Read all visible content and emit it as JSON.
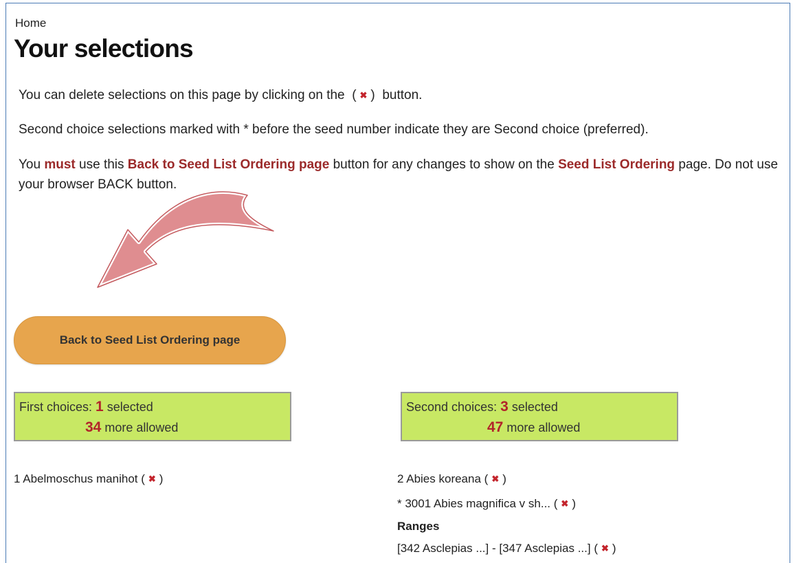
{
  "breadcrumb": "Home",
  "page_title": "Your selections",
  "intro": {
    "delete_text_before": "You can delete selections on this page by clicking on the",
    "delete_paren_open": "(",
    "delete_paren_close": ")",
    "delete_text_after": "button.",
    "second_choice_text": "Second choice selections marked with * before the seed number indicate they are Second choice (preferred).",
    "must_part1": "You",
    "must_word": "must",
    "must_part2": "use this",
    "back_link_text": "Back to Seed List Ordering page",
    "must_part3": "button for any changes to show on the",
    "seed_list_text": "Seed List Ordering",
    "must_part4": "page. Do not use your browser BACK button."
  },
  "delete_glyph": "✖",
  "back_button_label": "Back to Seed List Ordering page",
  "first_choices": {
    "label": "First choices:",
    "selected_count": "1",
    "selected_label": "selected",
    "more_count": "34",
    "more_label": "more allowed"
  },
  "second_choices": {
    "label": "Second choices:",
    "selected_count": "3",
    "selected_label": "selected",
    "more_count": "47",
    "more_label": "more allowed"
  },
  "first_list": [
    {
      "text": "1 Abelmoschus manihot ("
    }
  ],
  "second_list": [
    {
      "text": "2 Abies koreana ("
    },
    {
      "text": "* 3001 Abies magnifica v sh... ("
    }
  ],
  "ranges_heading": "Ranges",
  "ranges": [
    {
      "text": "[342 Asclepias ...] - [347 Asclepias ...] ("
    }
  ],
  "close_paren": ")",
  "colors": {
    "accent_red": "#9b2a2a",
    "button_orange": "#e7a54d",
    "box_green": "#c8e864",
    "arrow_pink": "#d9797c"
  },
  "icons": {
    "delete": "delete-x-icon",
    "arrow": "curved-arrow-icon"
  }
}
